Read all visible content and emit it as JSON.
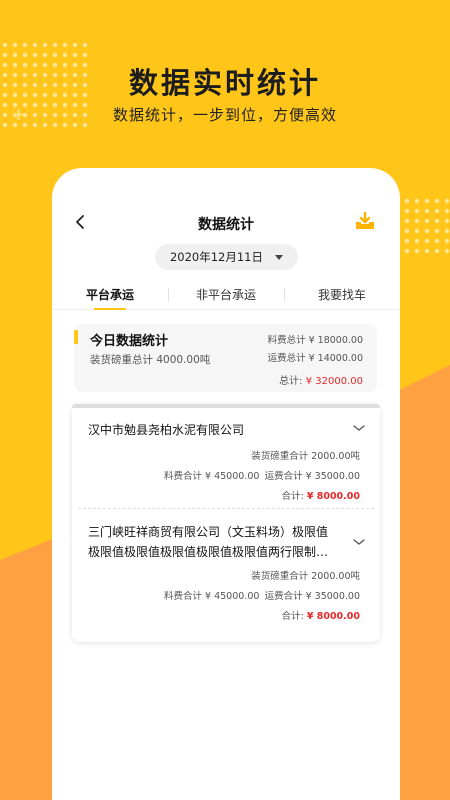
{
  "hero": {
    "title": "数据实时统计",
    "subtitle": "数据统计，一步到位，方便高效"
  },
  "nav": {
    "back_icon": "chevron-left-icon",
    "title": "数据统计",
    "download_icon": "download-tray-icon"
  },
  "date_picker": {
    "value": "2020年12月11日"
  },
  "tabs": [
    {
      "label": "平台承运",
      "active": true
    },
    {
      "label": "非平台承运",
      "active": false
    },
    {
      "label": "我要找车",
      "active": false
    }
  ],
  "summary": {
    "title": "今日数据统计",
    "weight": "装货磅重总计 4000.00吨",
    "fee": "料费总计 ¥ 18000.00",
    "freight": "运费总计 ¥ 14000.00",
    "total_label": "总计:",
    "total_value": "¥ 32000.00"
  },
  "companies": [
    {
      "name": "汉中市勉县尧柏水泥有限公司",
      "weight": "装货磅重合计 2000.00吨",
      "fee": "料费合计 ¥ 45000.00",
      "freight": "运费合计 ¥ 35000.00",
      "total_label": "合计:",
      "total_value": "¥ 8000.00"
    },
    {
      "name": "三门峡旺祥商贸有限公司（文玉料场）极限值极限值极限值极限值极限值极限值两行限制显示",
      "weight": "装货磅重合计 2000.00吨",
      "fee": "料费合计 ¥ 45000.00",
      "freight": "运费合计 ¥ 35000.00",
      "total_label": "合计:",
      "total_value": "¥ 8000.00"
    }
  ],
  "colors": {
    "accent": "#ffc619",
    "orange_wave": "#ff9e3d",
    "total_red": "#e52a2a"
  }
}
